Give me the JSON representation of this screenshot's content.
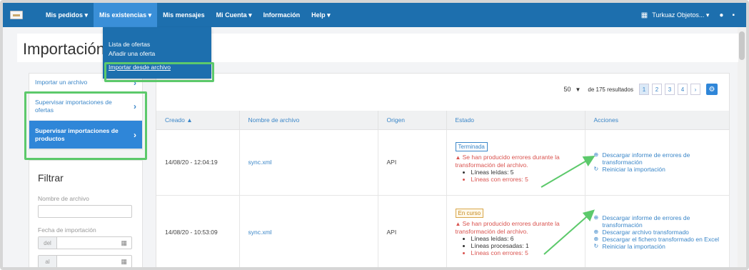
{
  "nav": {
    "items": [
      "Mis pedidos ▾",
      "Mis existencias ▾",
      "Mis mensajes",
      "Mi Cuenta ▾",
      "Información",
      "Help ▾"
    ],
    "shop": "Turkuaz Objetos... ▾",
    "shop_icon": "store-icon",
    "user_icon": "user-icon",
    "lock_icon": "lock-icon"
  },
  "dropdown": {
    "items": [
      "Lista de ofertas",
      "Añadir una oferta",
      "Importar desde archivo"
    ]
  },
  "page": {
    "title": "Importación de productos"
  },
  "sidebar": {
    "items": [
      {
        "label": "Importar un archivo"
      },
      {
        "label": "Supervisar importaciones de ofertas"
      },
      {
        "label": "Supervisar importaciones de productos"
      }
    ]
  },
  "filter": {
    "title": "Filtrar",
    "file_name_label": "Nombre de archivo",
    "date_label": "Fecha de importación",
    "from_prefix": "del",
    "to_prefix": "al"
  },
  "pager": {
    "per_page": "50",
    "results": "de 175 resultados",
    "pages": [
      "1",
      "2",
      "3",
      "4",
      "›"
    ]
  },
  "table": {
    "headers": [
      "Creado ▲",
      "Nombre de archivo",
      "Origen",
      "Estado",
      "Acciones"
    ],
    "rows": [
      {
        "created": "14/08/20 - 12:04:19",
        "file": "sync.xml",
        "origin": "API",
        "status": "Terminada",
        "error": "Se han producido errores durante la transformación del archivo.",
        "lines": [
          "Líneas leídas: 5",
          "Líneas con errores: 5"
        ],
        "actions": [
          "Descargar informe de errores de transformación",
          "Reiniciar la importación"
        ]
      },
      {
        "created": "14/08/20 - 10:53:09",
        "file": "sync.xml",
        "origin": "API",
        "status": "En curso",
        "error": "Se han producido errores durante la transformación del archivo.",
        "lines": [
          "Líneas leídas: 6",
          "Líneas procesadas: 1",
          "Líneas con errores: 5"
        ],
        "actions": [
          "Descargar informe de errores de transformación",
          "Descargar archivo transformado",
          "Descargar el fichero transformado en Excel",
          "Reiniciar la importación"
        ]
      }
    ]
  },
  "colors": {
    "nav": "#1d6fae",
    "accent": "#2f86d8",
    "highlight": "#5cc96b",
    "error": "#d9534f"
  }
}
